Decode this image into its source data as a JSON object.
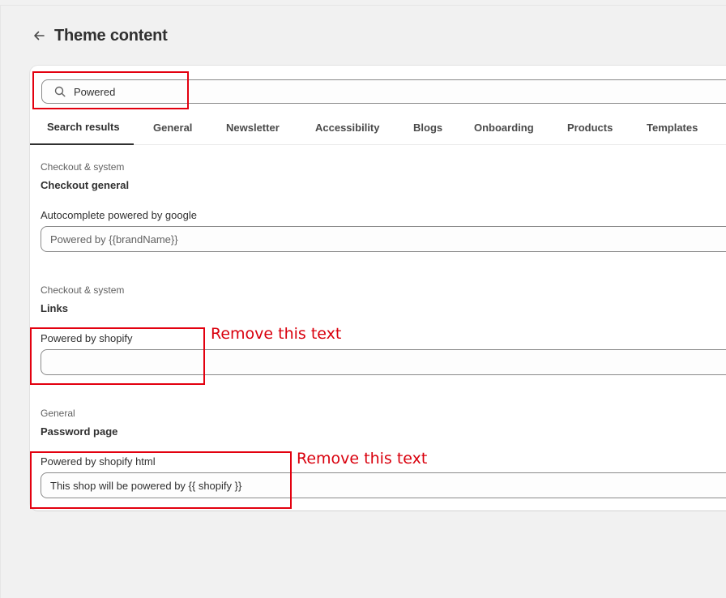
{
  "header": {
    "back_icon": "arrow-left-icon",
    "title": "Theme content"
  },
  "search": {
    "icon": "search-icon",
    "value": "Powered"
  },
  "tabs": [
    {
      "label": "Search results",
      "active": true
    },
    {
      "label": "General",
      "active": false
    },
    {
      "label": "Newsletter",
      "active": false
    },
    {
      "label": "Accessibility",
      "active": false
    },
    {
      "label": "Blogs",
      "active": false
    },
    {
      "label": "Onboarding",
      "active": false
    },
    {
      "label": "Products",
      "active": false
    },
    {
      "label": "Templates",
      "active": false
    }
  ],
  "groups": [
    {
      "category": "Checkout & system",
      "title": "Checkout general",
      "field_label": "Autocomplete powered by google",
      "field_value": "",
      "field_placeholder": "Powered by {{brandName}}"
    },
    {
      "category": "Checkout & system",
      "title": "Links",
      "field_label": "Powered by shopify",
      "field_value": "",
      "field_placeholder": ""
    },
    {
      "category": "General",
      "title": "Password page",
      "field_label": "Powered by shopify html",
      "field_value": "This shop will be powered by {{ shopify }}",
      "field_placeholder": ""
    }
  ],
  "annotations": [
    {
      "text": "Remove this text"
    },
    {
      "text": "Remove this text"
    }
  ],
  "colors": {
    "background": "#f1f1f1",
    "card": "#ffffff",
    "annotation_red": "#e3000f",
    "text_primary": "#303030",
    "text_secondary": "#616161"
  }
}
